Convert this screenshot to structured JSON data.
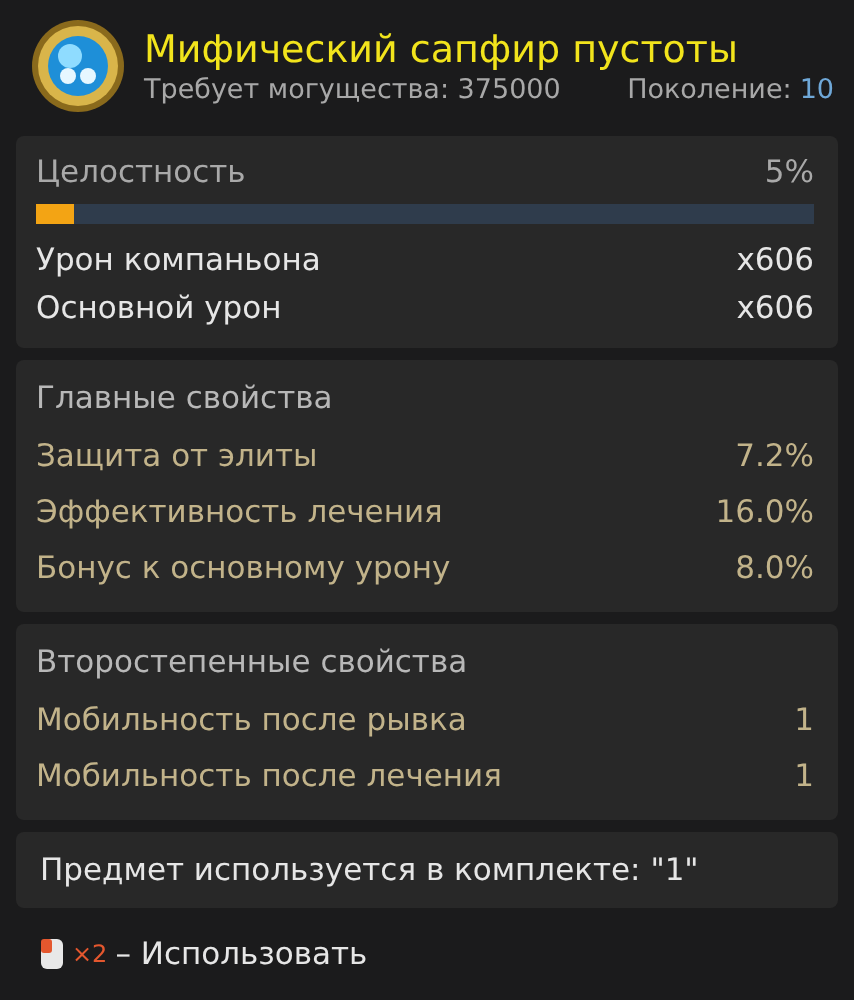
{
  "item": {
    "title": "Мифический сапфир пустоты",
    "requirement": "Требует могущества: 375000",
    "generation_label": "Поколение:",
    "generation": "10"
  },
  "durability": {
    "label": "Целостность",
    "reading": "5%",
    "level": 0.05
  },
  "stats": [
    {
      "name": "Урон компаньона",
      "value": "x606"
    },
    {
      "name": "Основной урон",
      "value": "x606"
    }
  ],
  "main_properties": {
    "heading": "Главные свойства",
    "rows": [
      {
        "name": "Защита от элиты",
        "value": "7.2%"
      },
      {
        "name": "Эффективность лечения",
        "value": "16.0%"
      },
      {
        "name": "Бонус к основному урону",
        "value": "8.0%"
      }
    ]
  },
  "secondary_properties": {
    "heading": "Второстепенные свойства",
    "rows": [
      {
        "name": "Мобильность после рывка",
        "value": "1"
      },
      {
        "name": "Мобильность после лечения",
        "value": "1"
      }
    ]
  },
  "set_note": "Предмет используется в комплекте: \"1\"",
  "footer": {
    "multiplier": "×2",
    "action": "– Использовать"
  }
}
